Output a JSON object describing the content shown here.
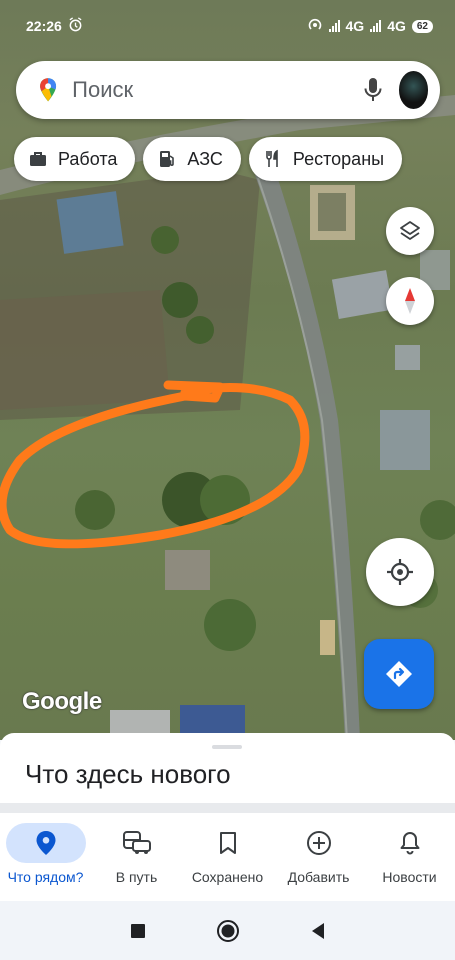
{
  "status_bar": {
    "time": "22:26",
    "network_1": "4G",
    "network_2": "4G",
    "battery": "62"
  },
  "search": {
    "placeholder": "Поиск"
  },
  "chips": [
    {
      "label": "Работа",
      "icon": "briefcase-icon"
    },
    {
      "label": "АЗС",
      "icon": "gas-station-icon"
    },
    {
      "label": "Рестораны",
      "icon": "restaurant-icon"
    }
  ],
  "map": {
    "attribution": "Google",
    "highlight_color": "#ff7a1a"
  },
  "sheet": {
    "title": "Что здесь нового"
  },
  "bottom_nav": [
    {
      "label": "Что рядом?",
      "icon": "location-pin-icon",
      "active": true
    },
    {
      "label": "В путь",
      "icon": "commute-icon",
      "active": false
    },
    {
      "label": "Сохранено",
      "icon": "bookmark-icon",
      "active": false
    },
    {
      "label": "Добавить",
      "icon": "add-circle-icon",
      "active": false
    },
    {
      "label": "Новости",
      "icon": "bell-icon",
      "active": false
    }
  ],
  "colors": {
    "accent": "#0b57d0",
    "directions_fab": "#1a73e8"
  }
}
